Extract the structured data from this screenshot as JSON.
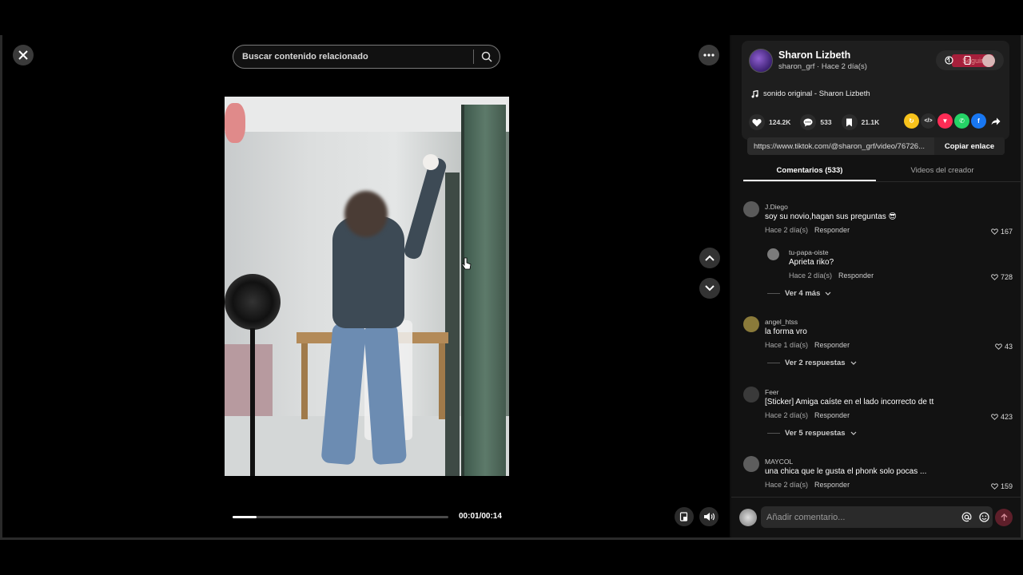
{
  "search": {
    "placeholder": "Buscar contenido relacionado"
  },
  "player": {
    "time": "00:01/00:14",
    "progress_fraction": 0.11
  },
  "creator": {
    "name": "Sharon Lizbeth",
    "subline": "sharon_grf · Hace 2 día(s)",
    "follow_label": "Seguir",
    "music": "sonido original - Sharon Lizbeth"
  },
  "stats": {
    "likes": "124.2K",
    "comments": "533",
    "saves": "21.1K"
  },
  "share": {
    "url": "https://www.tiktok.com/@sharon_grf/video/76726...",
    "copy_label": "Copiar enlace"
  },
  "tabs": {
    "comments": "Comentarios (533)",
    "creator_videos": "Videos del creador"
  },
  "comments": [
    {
      "user": "J.Diego",
      "text": "soy su novio,hagan sus preguntas 😎",
      "time": "Hace 2 día(s)",
      "reply": "Responder",
      "likes": "167"
    },
    {
      "user": "tu-papa-oiste",
      "text": "Aprieta riko?",
      "time": "Hace 2 día(s)",
      "reply": "Responder",
      "likes": "728"
    },
    {
      "user": "angel_htss",
      "text": "la forma vro",
      "time": "Hace 1 día(s)",
      "reply": "Responder",
      "likes": "43"
    },
    {
      "user": "Feer",
      "text": "[Sticker] Amiga caíste en el lado incorrecto de tt",
      "time": "Hace 2 día(s)",
      "reply": "Responder",
      "likes": "423"
    },
    {
      "user": "MAYCOL",
      "text": "una chica que le gusta el phonk solo pocas ...",
      "time": "Hace 2 día(s)",
      "reply": "Responder",
      "likes": "159"
    }
  ],
  "more_replies": {
    "first": "Ver 4 más",
    "second": "Ver 2 respuestas",
    "third": "Ver 5 respuestas"
  },
  "comment_input": {
    "placeholder": "Añadir comentario..."
  },
  "colors": {
    "accent_red": "#fe2c55",
    "panel_bg": "#121212"
  },
  "icons": [
    "close-icon",
    "more-icon",
    "search-icon",
    "chevron-up-icon",
    "chevron-down-icon",
    "volume-icon",
    "heart-icon",
    "comment-icon",
    "bookmark-icon",
    "music-icon",
    "at-icon",
    "emoji-icon",
    "send-icon"
  ]
}
